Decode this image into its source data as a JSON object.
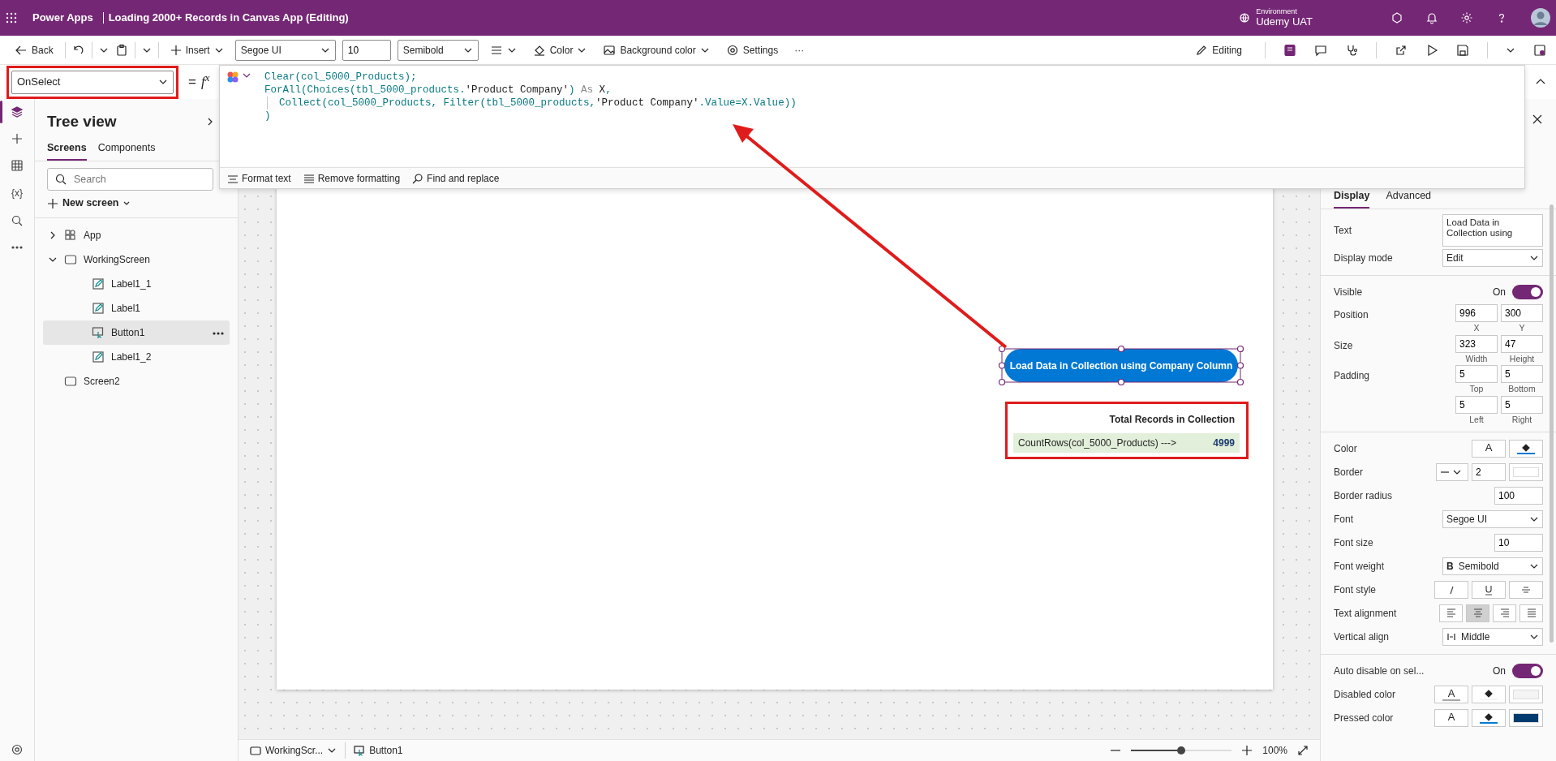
{
  "app_bar": {
    "product": "Power Apps",
    "title": "Loading 2000+ Records in Canvas App (Editing)",
    "environment_label": "Environment",
    "environment": "Udemy UAT"
  },
  "toolbar": {
    "back": "Back",
    "insert": "Insert",
    "font": "Segoe UI",
    "font_size": "10",
    "font_weight": "Semibold",
    "color_label": "Color",
    "background_color_label": "Background color",
    "settings": "Settings",
    "more": "···",
    "editing": "Editing"
  },
  "formula_bar": {
    "property": "OnSelect",
    "equals": "=",
    "fx": "f$^{x}$",
    "lines": [
      {
        "indent": false,
        "segments": [
          {
            "kind": "fn",
            "text": "Clear(col_5000_Products);"
          }
        ]
      },
      {
        "indent": false,
        "segments": [
          {
            "kind": "fn",
            "text": "ForAll(Choices(tbl_5000_products."
          },
          {
            "kind": "str",
            "text": "'Product Company'"
          },
          {
            "kind": "fn",
            "text": ") "
          },
          {
            "kind": "kw",
            "text": "As"
          },
          {
            "kind": "str",
            "text": " X"
          },
          {
            "kind": "fn",
            "text": ","
          }
        ]
      },
      {
        "indent": true,
        "segments": [
          {
            "kind": "fn",
            "text": "Collect(col_5000_Products, Filter(tbl_5000_products,"
          },
          {
            "kind": "str",
            "text": "'Product Company'"
          },
          {
            "kind": "fn",
            "text": ".Value=X.Value))"
          }
        ]
      },
      {
        "indent": false,
        "segments": [
          {
            "kind": "fn",
            "text": ")"
          }
        ]
      }
    ],
    "tools": [
      "Format text",
      "Remove formatting",
      "Find and replace"
    ]
  },
  "rail": [
    {
      "kind": "layers",
      "selected": true
    },
    {
      "kind": "insert",
      "selected": false
    },
    {
      "kind": "data",
      "selected": false
    },
    {
      "kind": "variables",
      "label": "{x}",
      "selected": false
    },
    {
      "kind": "search",
      "selected": false
    },
    {
      "kind": "more",
      "selected": false
    }
  ],
  "tree": {
    "title": "Tree view",
    "tabs": [
      {
        "label": "Screens",
        "selected": true
      },
      {
        "label": "Components",
        "selected": false
      }
    ],
    "search": {
      "placeholder": "Search"
    },
    "new_screen": "New screen",
    "items": [
      {
        "kind": "app",
        "label": "App",
        "expanded": false,
        "selected": false
      },
      {
        "kind": "screen",
        "label": "WorkingScreen",
        "expanded": true,
        "selected": false,
        "children": [
          {
            "kind": "label",
            "label": "Label1_1",
            "selected": false
          },
          {
            "kind": "label",
            "label": "Label1",
            "selected": false
          },
          {
            "kind": "button",
            "label": "Button1",
            "selected": true
          },
          {
            "kind": "label",
            "label": "Label1_2",
            "selected": false
          }
        ]
      },
      {
        "kind": "screen",
        "label": "Screen2",
        "selected": false
      }
    ]
  },
  "canvas": {
    "button": {
      "text": "Load Data in Collection using Company Column",
      "selected": true
    },
    "label_title": "Total Records in Collection",
    "label_formula": "CountRows(col_5000_Products) --->",
    "label_value": "4999"
  },
  "properties": {
    "tabs": [
      {
        "label": "Display",
        "selected": true
      },
      {
        "label": "Advanced",
        "selected": false
      }
    ],
    "sections": [
      [
        {
          "kind": "textarea",
          "label": "Text",
          "value": "Load Data in Collection using"
        },
        {
          "kind": "select",
          "label": "Display mode",
          "value": "Edit"
        }
      ],
      [
        {
          "kind": "toggle",
          "label": "Visible",
          "state": "On",
          "on": true
        },
        {
          "kind": "pair",
          "label": "Position",
          "fields": [
            {
              "value": "996",
              "caption": "X"
            },
            {
              "value": "300",
              "caption": "Y"
            }
          ]
        },
        {
          "kind": "pair",
          "label": "Size",
          "fields": [
            {
              "value": "323",
              "caption": "Width"
            },
            {
              "value": "47",
              "caption": "Height"
            }
          ]
        },
        {
          "kind": "pair",
          "label": "Padding",
          "fields": [
            {
              "value": "5",
              "caption": "Top"
            },
            {
              "value": "5",
              "caption": "Bottom"
            }
          ]
        },
        {
          "kind": "pair",
          "fields": [
            {
              "value": "5",
              "caption": "Left"
            },
            {
              "value": "5",
              "caption": "Right"
            }
          ]
        }
      ],
      [
        {
          "kind": "swatches",
          "label": "Color",
          "swatches": [
            {
              "kind": "text",
              "glyph": "A",
              "color": "#ffffff"
            },
            {
              "kind": "fill",
              "color": "#0078d4"
            }
          ]
        },
        {
          "kind": "border",
          "label": "Border",
          "value": "2",
          "swatches": [
            {
              "kind": "solid",
              "color": "#ffffff"
            }
          ]
        },
        {
          "kind": "number",
          "label": "Border radius",
          "value": "100"
        },
        {
          "kind": "select",
          "label": "Font",
          "value": "Segoe UI"
        },
        {
          "kind": "number",
          "label": "Font size",
          "value": "10"
        },
        {
          "kind": "select",
          "label": "Font weight",
          "value": "Semibold",
          "prefix": "B"
        },
        {
          "kind": "buttons",
          "label": "Font style",
          "buttons": [
            {
              "kind": "italic",
              "selected": false
            },
            {
              "kind": "underline",
              "selected": false
            },
            {
              "kind": "strike",
              "selected": false
            }
          ]
        },
        {
          "kind": "buttons",
          "label": "Text alignment",
          "buttons": [
            {
              "kind": "left",
              "selected": false
            },
            {
              "kind": "center",
              "selected": true
            },
            {
              "kind": "right",
              "selected": false
            },
            {
              "kind": "justify",
              "selected": false
            }
          ]
        },
        {
          "kind": "valign-select",
          "label": "Vertical align",
          "value": "Middle"
        }
      ],
      [
        {
          "kind": "toggle",
          "label": "Auto disable on sel...",
          "state": "On",
          "on": true
        },
        {
          "kind": "swatches",
          "label": "Disabled color",
          "swatches": [
            {
              "kind": "text",
              "glyph": "A",
              "color": "#a6a6a6"
            },
            {
              "kind": "fill",
              "color": "#f4f4f4"
            },
            {
              "kind": "solid",
              "color": "#f4f4f4"
            }
          ]
        },
        {
          "kind": "swatches",
          "label": "Pressed color",
          "swatches": [
            {
              "kind": "text",
              "glyph": "A",
              "color": "#ffffff"
            },
            {
              "kind": "fill",
              "color": "#0078d4"
            },
            {
              "kind": "solid",
              "color": "#003b6f"
            }
          ]
        }
      ]
    ]
  },
  "status_bar": {
    "screen": "WorkingScr...",
    "control": "Button1",
    "zoom_slider": {
      "level": 0.5
    },
    "zoom": "100%"
  }
}
